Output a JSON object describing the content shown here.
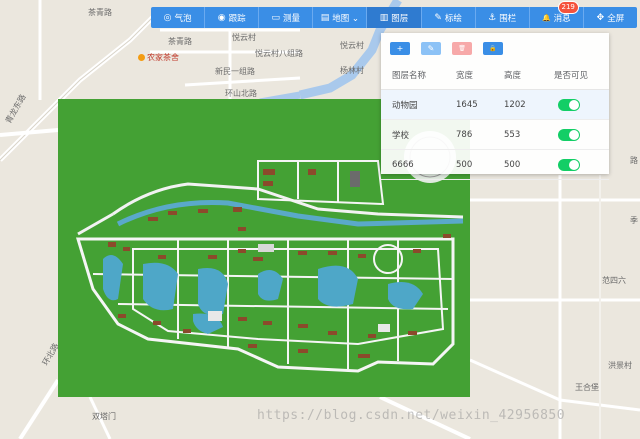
{
  "toolbar": {
    "items": [
      {
        "icon": "eye-off-icon",
        "glyph": "◎",
        "label": "气泡"
      },
      {
        "icon": "eye-icon",
        "glyph": "◉",
        "label": "跟踪"
      },
      {
        "icon": "ruler-icon",
        "glyph": "▭",
        "label": "测量"
      },
      {
        "icon": "map-icon",
        "glyph": "▤",
        "label": "地图 ⌄"
      },
      {
        "icon": "layers-icon",
        "glyph": "▥",
        "label": "图层"
      },
      {
        "icon": "brush-icon",
        "glyph": "✎",
        "label": "标绘"
      },
      {
        "icon": "anchor-icon",
        "glyph": "⚓",
        "label": "围栏"
      },
      {
        "icon": "bell-icon",
        "glyph": "🔔",
        "label": "消息"
      },
      {
        "icon": "fullscreen-icon",
        "glyph": "✥",
        "label": "全屏"
      }
    ],
    "message_count": "219"
  },
  "panel": {
    "buttons": [
      {
        "icon": "plus-icon",
        "glyph": "+"
      },
      {
        "icon": "edit-icon",
        "glyph": "✎"
      },
      {
        "icon": "delete-icon",
        "glyph": "🗑"
      },
      {
        "icon": "lock-icon",
        "glyph": "🔒"
      }
    ],
    "columns": [
      "图层名称",
      "宽度",
      "高度",
      "是否可见"
    ],
    "rows": [
      {
        "name": "动物园",
        "width": "1645",
        "height": "1202",
        "visible": true
      },
      {
        "name": "学校",
        "width": "786",
        "height": "553",
        "visible": true
      },
      {
        "name": "6666",
        "width": "500",
        "height": "500",
        "visible": true
      }
    ]
  },
  "map_labels": {
    "l1": "茶青路",
    "l2": "农家茶舍",
    "l3": "悦云村",
    "l4": "悦云村八组路",
    "l5": "新民一组路",
    "l6": "环山北路",
    "l7": "青龙东路",
    "l8": "范四六",
    "l9": "洪景村",
    "l10": "王合堡",
    "l11": "双塔门",
    "l12": "杨林村",
    "l13": "悦云村",
    "l14": "茶青路",
    "l15": "环北路",
    "l16": "路",
    "l17": "季"
  },
  "watermark": "https://blog.csdn.net/weixin_42956850"
}
